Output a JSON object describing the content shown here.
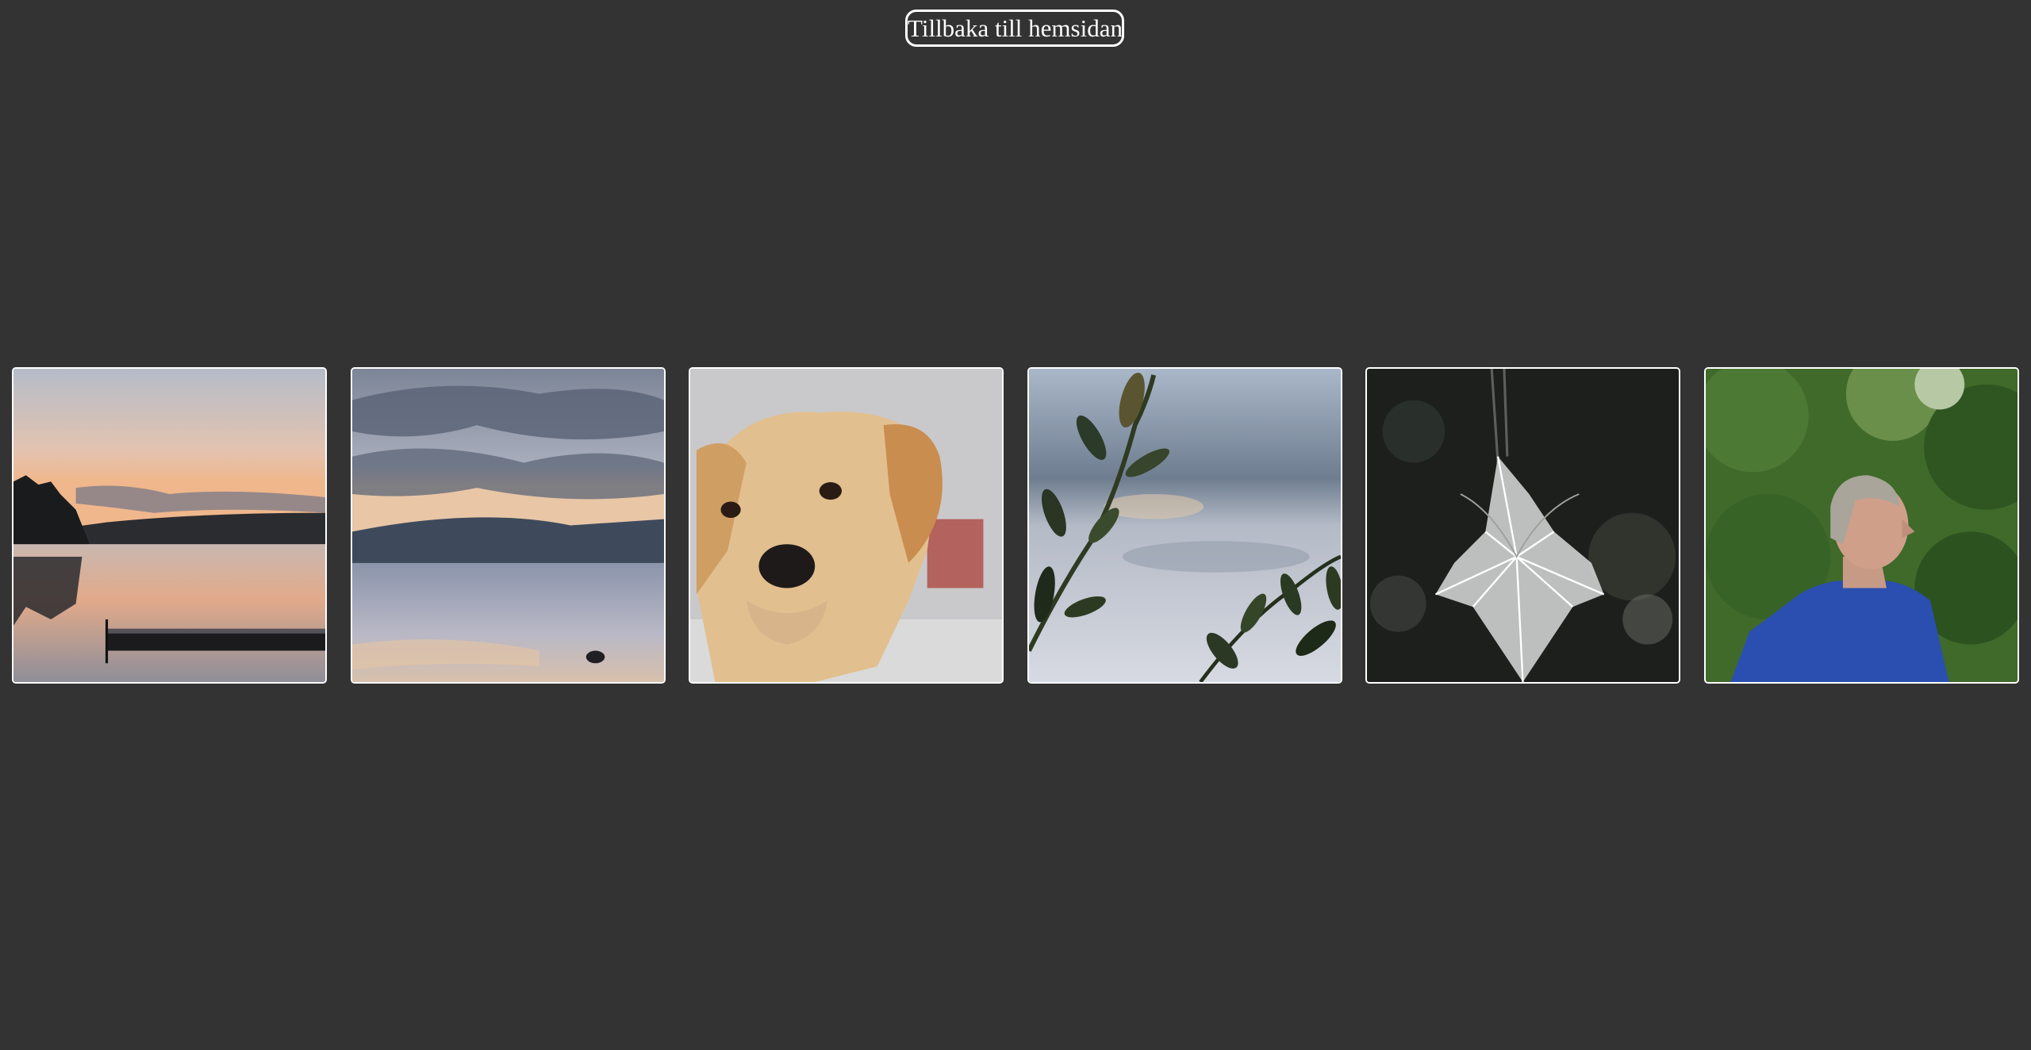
{
  "header": {
    "back_label": "Tillbaka till hemsidan"
  },
  "colors": {
    "background": "#333333",
    "border": "#ffffff",
    "text": "#ffffff"
  },
  "gallery": {
    "items": [
      {
        "subject": "lake-sunset-with-dock"
      },
      {
        "subject": "lake-cloudy-sky"
      },
      {
        "subject": "labrador-dog-portrait"
      },
      {
        "subject": "leaves-over-lake"
      },
      {
        "subject": "frosted-spider-web"
      },
      {
        "subject": "elderly-man-in-forest"
      }
    ]
  }
}
